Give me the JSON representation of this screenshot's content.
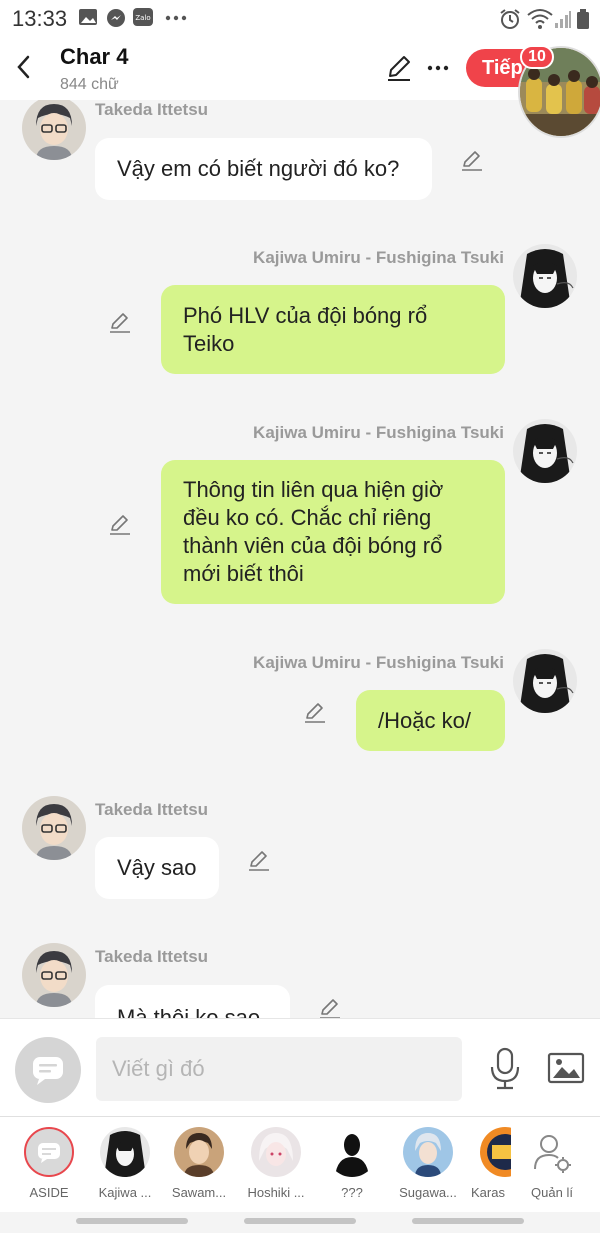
{
  "status_bar": {
    "time": "13:33",
    "icons_left": [
      "image-icon",
      "messenger-icon",
      "zalo-icon",
      "more-dots-icon"
    ],
    "icons_right": [
      "alarm-icon",
      "wifi-icon",
      "signal-icon",
      "battery-icon"
    ],
    "zalo_text": "Zalo"
  },
  "header": {
    "title": "Char 4",
    "subtitle": "844 chữ",
    "next_label": "Tiếp",
    "next_badge": "10",
    "accent_color": "#f0434a"
  },
  "messages": [
    {
      "side": "left",
      "name": "Takeda Ittetsu",
      "text": "Vậy em có biết người đó ko?"
    },
    {
      "side": "right",
      "name": "Kajiwa Umiru - Fushigina Tsuki",
      "text": "Phó HLV của đội bóng rổ Teiko"
    },
    {
      "side": "right",
      "name": "Kajiwa Umiru - Fushigina Tsuki",
      "text": "Thông tin liên qua hiện giờ đều ko có. Chắc chỉ riêng thành viên của đội bóng rổ mới biết thôi"
    },
    {
      "side": "right",
      "name": "Kajiwa Umiru - Fushigina Tsuki",
      "text": "/Hoặc ko/"
    },
    {
      "side": "left",
      "name": "Takeda Ittetsu",
      "text": "Vậy sao"
    },
    {
      "side": "left",
      "name": "Takeda Ittetsu",
      "text": "Mà thôi ko sao"
    }
  ],
  "bubble_colors": {
    "left": "#ffffff",
    "right": "#d6f48b"
  },
  "input": {
    "placeholder": "Viết gì đó",
    "value": ""
  },
  "characters": [
    {
      "label": "ASIDE"
    },
    {
      "label": "Kajiwa ..."
    },
    {
      "label": "Sawam..."
    },
    {
      "label": "Hoshiki ..."
    },
    {
      "label": "???"
    },
    {
      "label": "Sugawa..."
    },
    {
      "label": "Karas"
    },
    {
      "label": "Quản lí"
    }
  ]
}
